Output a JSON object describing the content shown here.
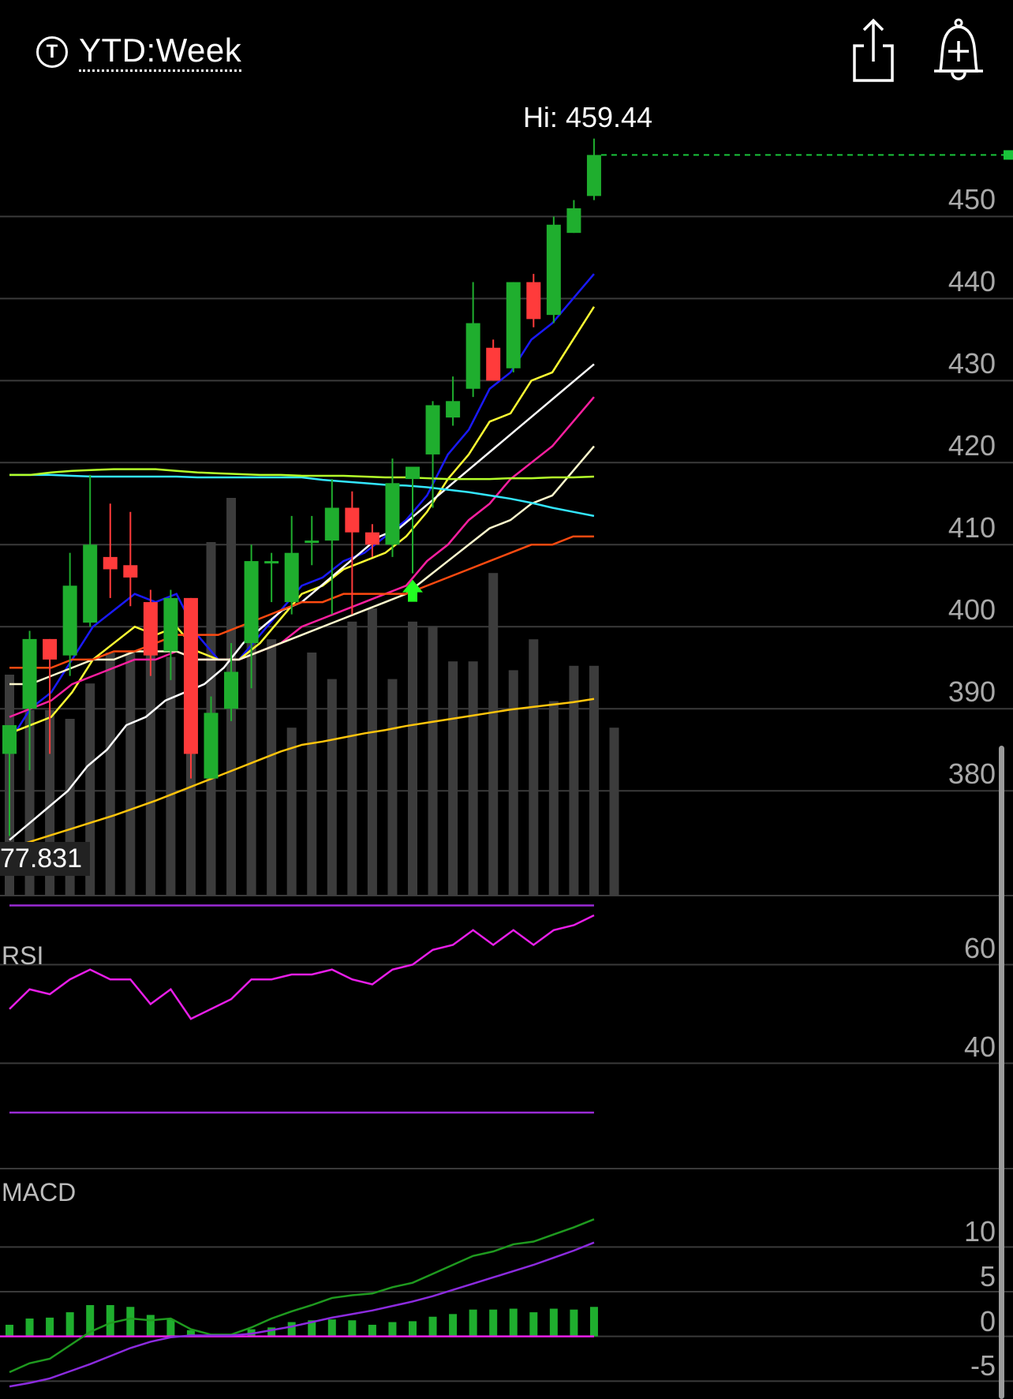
{
  "header": {
    "symbol_icon": "T",
    "timeframe_label": "YTD:Week",
    "share_icon": "share-icon",
    "alert_icon": "add-alert-bell-icon"
  },
  "chart_data": [
    {
      "type": "candlestick",
      "panel": "price",
      "hi_label": "Hi: 459.44",
      "y_ticks": [
        "450",
        "440",
        "430",
        "420",
        "410",
        "400",
        "390",
        "380"
      ],
      "ylim": [
        373,
        461
      ],
      "volume_label": "77.831",
      "colors": {
        "up": "#1fae2e",
        "down": "#ff3b3b",
        "grid": "#3a3a3a",
        "hi_line": "#19c43a",
        "volume": "#3c3c3c"
      },
      "candles": [
        {
          "o": 384.5,
          "h": 387.5,
          "l": 374.5,
          "c": 388.0
        },
        {
          "o": 390.0,
          "h": 399.5,
          "l": 382.5,
          "c": 398.5
        },
        {
          "o": 398.5,
          "h": 398.0,
          "l": 384.5,
          "c": 396.0
        },
        {
          "o": 396.5,
          "h": 409.0,
          "l": 394.0,
          "c": 405.0
        },
        {
          "o": 400.5,
          "h": 418.5,
          "l": 400.0,
          "c": 410.0
        },
        {
          "o": 408.5,
          "h": 415.0,
          "l": 403.5,
          "c": 407.0
        },
        {
          "o": 407.5,
          "h": 414.0,
          "l": 402.5,
          "c": 406.0
        },
        {
          "o": 403.0,
          "h": 404.5,
          "l": 394.0,
          "c": 396.5
        },
        {
          "o": 397.0,
          "h": 404.5,
          "l": 393.5,
          "c": 403.5
        },
        {
          "o": 403.5,
          "h": 403.0,
          "l": 381.5,
          "c": 384.5
        },
        {
          "o": 381.5,
          "h": 391.5,
          "l": 382.0,
          "c": 389.5
        },
        {
          "o": 390.0,
          "h": 398.0,
          "l": 388.5,
          "c": 394.5
        },
        {
          "o": 398.0,
          "h": 410.0,
          "l": 392.5,
          "c": 408.0
        },
        {
          "o": 408.0,
          "h": 409.0,
          "l": 403.0,
          "c": 408.0
        },
        {
          "o": 403.0,
          "h": 413.5,
          "l": 401.5,
          "c": 409.0
        },
        {
          "o": 410.5,
          "h": 413.5,
          "l": 407.5,
          "c": 410.5
        },
        {
          "o": 410.5,
          "h": 418.0,
          "l": 401.5,
          "c": 414.5
        },
        {
          "o": 414.5,
          "h": 416.5,
          "l": 401.5,
          "c": 411.5
        },
        {
          "o": 411.5,
          "h": 412.5,
          "l": 408.5,
          "c": 410.0
        },
        {
          "o": 410.0,
          "h": 420.5,
          "l": 408.5,
          "c": 417.5
        },
        {
          "o": 418.0,
          "h": 419.5,
          "l": 406.5,
          "c": 419.5
        },
        {
          "o": 421.0,
          "h": 427.5,
          "l": 414.5,
          "c": 427.0
        },
        {
          "o": 425.5,
          "h": 430.5,
          "l": 424.5,
          "c": 427.5
        },
        {
          "o": 429.0,
          "h": 442.0,
          "l": 428.0,
          "c": 437.0
        },
        {
          "o": 434.0,
          "h": 435.0,
          "l": 430.0,
          "c": 430.0
        },
        {
          "o": 431.5,
          "h": 442.0,
          "l": 431.0,
          "c": 442.0
        },
        {
          "o": 442.0,
          "h": 443.0,
          "l": 436.5,
          "c": 437.5
        },
        {
          "o": 438.0,
          "h": 450.0,
          "l": 437.0,
          "c": 449.0
        },
        {
          "o": 448.0,
          "h": 452.0,
          "l": 448.5,
          "c": 451.0
        },
        {
          "o": 452.5,
          "h": 459.5,
          "l": 452.0,
          "c": 457.5
        }
      ],
      "volume_scale_max": 100,
      "volume": [
        50,
        42,
        42,
        40,
        48,
        55,
        55,
        56,
        54,
        60,
        80,
        90,
        64,
        58,
        38,
        55,
        49,
        62,
        65,
        49,
        62,
        61,
        53,
        53,
        73,
        51,
        58,
        44,
        52,
        52,
        38
      ],
      "signal_arrow_index": 20,
      "moving_averages": [
        {
          "color": "#1a1aff",
          "values": [
            386,
            390,
            392,
            396,
            400,
            402,
            404,
            403,
            404,
            399,
            396,
            396,
            399,
            402,
            405,
            406,
            408,
            409,
            411,
            413,
            416,
            421,
            424,
            429,
            431,
            435,
            437,
            440,
            443
          ]
        },
        {
          "color": "#ffff33",
          "values": [
            387,
            388,
            389,
            392,
            396,
            398,
            400,
            399,
            400,
            397,
            396,
            396,
            398,
            401,
            404,
            405,
            407,
            408,
            409,
            411,
            414,
            418,
            421,
            425,
            426,
            430,
            431,
            435,
            439
          ]
        },
        {
          "color": "#ffffff",
          "values": [
            374,
            376,
            378,
            380,
            383,
            385,
            388,
            389,
            391,
            392,
            393,
            395,
            398,
            400,
            402,
            403,
            405,
            407,
            409,
            411,
            412,
            414,
            416,
            418,
            420,
            422,
            424,
            426,
            428,
            430,
            432
          ]
        },
        {
          "color": "#ff1fa0",
          "values": [
            389,
            390,
            391,
            393,
            394,
            395,
            396,
            396,
            397,
            396,
            396,
            396,
            397,
            398,
            400,
            401,
            402,
            403,
            404,
            405,
            408,
            410,
            413,
            415,
            418,
            420,
            422,
            425,
            428
          ]
        },
        {
          "color": "#fffacd",
          "values": [
            393,
            393,
            394,
            395,
            396,
            396,
            397,
            397,
            397,
            396,
            396,
            396,
            397,
            398,
            399,
            400,
            401,
            402,
            403,
            404,
            406,
            408,
            410,
            412,
            413,
            415,
            416,
            419,
            422
          ]
        },
        {
          "color": "#ff4a10",
          "values": [
            395,
            395,
            395,
            396,
            396,
            397,
            397,
            398,
            399,
            399,
            399,
            400,
            401,
            402,
            403,
            403,
            404,
            404,
            404,
            404,
            405,
            406,
            407,
            408,
            409,
            410,
            410,
            411,
            411
          ]
        },
        {
          "color": "#33e6ff",
          "values": [
            418.5,
            418.5,
            418.5,
            418.4,
            418.3,
            418.3,
            418.3,
            418.3,
            418.3,
            418.2,
            418.2,
            418.2,
            418.2,
            418.2,
            418.2,
            417.9,
            417.7,
            417.5,
            417.3,
            417.2,
            417.0,
            416.7,
            416.4,
            416.0,
            415.6,
            415.1,
            414.5,
            414.0,
            413.5
          ]
        },
        {
          "color": "#b4ff2a",
          "values": [
            418.5,
            418.5,
            418.8,
            419.0,
            419.1,
            419.2,
            419.2,
            419.2,
            419.0,
            418.8,
            418.7,
            418.6,
            418.5,
            418.5,
            418.4,
            418.4,
            418.4,
            418.3,
            418.2,
            418.2,
            418.1,
            418.0,
            418.0,
            418.0,
            418.1,
            418.1,
            418.2,
            418.2,
            418.3
          ]
        },
        {
          "color": "#ffc40c",
          "values": [
            373.0,
            373.8,
            374.6,
            375.4,
            376.2,
            377.0,
            377.9,
            378.8,
            379.8,
            380.8,
            381.8,
            382.8,
            383.8,
            384.8,
            385.6,
            386.0,
            386.5,
            387.0,
            387.4,
            387.9,
            388.3,
            388.7,
            389.1,
            389.5,
            389.9,
            390.2,
            390.5,
            390.8,
            391.2
          ]
        }
      ]
    },
    {
      "type": "line",
      "panel": "rsi",
      "label": "RSI",
      "y_ticks": [
        "60",
        "40"
      ],
      "ylim": [
        22,
        78
      ],
      "bands": [
        72,
        30
      ],
      "band_color": "#9a2bd6",
      "series": [
        {
          "color": "#e81ee8",
          "values": [
            51,
            55,
            54,
            57,
            59,
            57,
            57,
            52,
            55,
            49,
            51,
            53,
            57,
            57,
            58,
            58,
            59,
            57,
            56,
            59,
            60,
            63,
            64,
            67,
            64,
            67,
            64,
            67,
            68,
            70
          ]
        }
      ]
    },
    {
      "type": "bar_line",
      "panel": "macd",
      "label": "MACD",
      "y_ticks": [
        "10",
        "5",
        "0",
        "-5"
      ],
      "ylim": [
        -7,
        14
      ],
      "zero_color": "#e81ee8",
      "histogram": [
        1.3,
        2.0,
        2.1,
        2.7,
        3.5,
        3.5,
        3.3,
        2.4,
        1.9,
        0.7,
        0.1,
        0.1,
        0.8,
        1.0,
        1.6,
        1.8,
        1.9,
        1.8,
        1.3,
        1.6,
        1.7,
        2.2,
        2.5,
        3.0,
        3.0,
        3.1,
        2.7,
        3.1,
        3.0,
        3.3
      ],
      "macd_line": {
        "color": "#1f9a1f",
        "values": [
          -4.0,
          -3.0,
          -2.5,
          -1.0,
          0.5,
          1.5,
          2.0,
          1.8,
          2.0,
          0.8,
          0.2,
          0.2,
          1.0,
          2.0,
          2.8,
          3.5,
          4.3,
          4.6,
          4.8,
          5.5,
          6.0,
          7.0,
          8.0,
          9.0,
          9.5,
          10.3,
          10.6,
          11.4,
          12.2,
          13.1
        ]
      },
      "signal_line": {
        "color": "#8c2bde",
        "values": [
          -5.6,
          -5.2,
          -4.7,
          -3.9,
          -3.1,
          -2.2,
          -1.3,
          -0.6,
          -0.1,
          0.1,
          0.1,
          0.1,
          0.3,
          0.7,
          1.1,
          1.6,
          2.1,
          2.5,
          2.9,
          3.4,
          3.9,
          4.5,
          5.2,
          5.9,
          6.6,
          7.3,
          8.0,
          8.8,
          9.6,
          10.5
        ]
      }
    }
  ]
}
